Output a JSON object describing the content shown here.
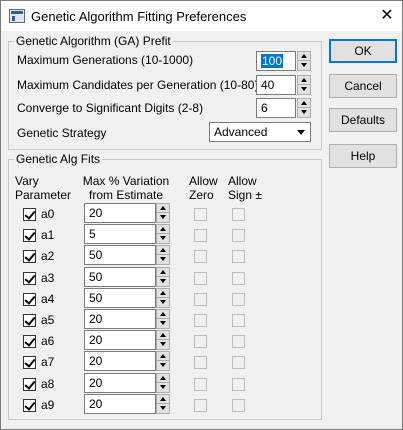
{
  "window": {
    "title": "Genetic Algorithm Fitting Preferences",
    "close_glyph": "✕",
    "icon": "app-window-icon"
  },
  "prefit": {
    "group_title": "Genetic Algorithm (GA) Prefit",
    "max_generations_label": "Maximum Generations (10-1000)",
    "max_generations_value": "100",
    "max_candidates_label": "Maximum Candidates per Generation (10-80)",
    "max_candidates_value": "40",
    "converge_label": "Converge to Significant Digits (2-8)",
    "converge_value": "6",
    "strategy_label": "Genetic Strategy",
    "strategy_value": "Advanced"
  },
  "buttons": {
    "ok": "OK",
    "cancel": "Cancel",
    "defaults": "Defaults",
    "help": "Help"
  },
  "fits": {
    "group_title": "Genetic Alg Fits",
    "header_vary_1": "Vary",
    "header_vary_2": "Parameter",
    "header_var_1": "Max % Variation",
    "header_var_2": "from Estimate",
    "header_zero_1": "Allow",
    "header_zero_2": "Zero",
    "header_sign_1": "Allow",
    "header_sign_2": "Sign ±",
    "rows": [
      {
        "param": "a0",
        "vary": true,
        "variation": "20",
        "allow_zero": false,
        "allow_sign": false
      },
      {
        "param": "a1",
        "vary": true,
        "variation": "5",
        "allow_zero": false,
        "allow_sign": false
      },
      {
        "param": "a2",
        "vary": true,
        "variation": "50",
        "allow_zero": false,
        "allow_sign": false
      },
      {
        "param": "a3",
        "vary": true,
        "variation": "50",
        "allow_zero": false,
        "allow_sign": false
      },
      {
        "param": "a4",
        "vary": true,
        "variation": "50",
        "allow_zero": false,
        "allow_sign": false
      },
      {
        "param": "a5",
        "vary": true,
        "variation": "20",
        "allow_zero": false,
        "allow_sign": false
      },
      {
        "param": "a6",
        "vary": true,
        "variation": "20",
        "allow_zero": false,
        "allow_sign": false
      },
      {
        "param": "a7",
        "vary": true,
        "variation": "20",
        "allow_zero": false,
        "allow_sign": false
      },
      {
        "param": "a8",
        "vary": true,
        "variation": "20",
        "allow_zero": false,
        "allow_sign": false
      },
      {
        "param": "a9",
        "vary": true,
        "variation": "20",
        "allow_zero": false,
        "allow_sign": false
      }
    ]
  },
  "colors": {
    "selection": "#0078d7",
    "dialog_bg": "#f0f0f0"
  }
}
